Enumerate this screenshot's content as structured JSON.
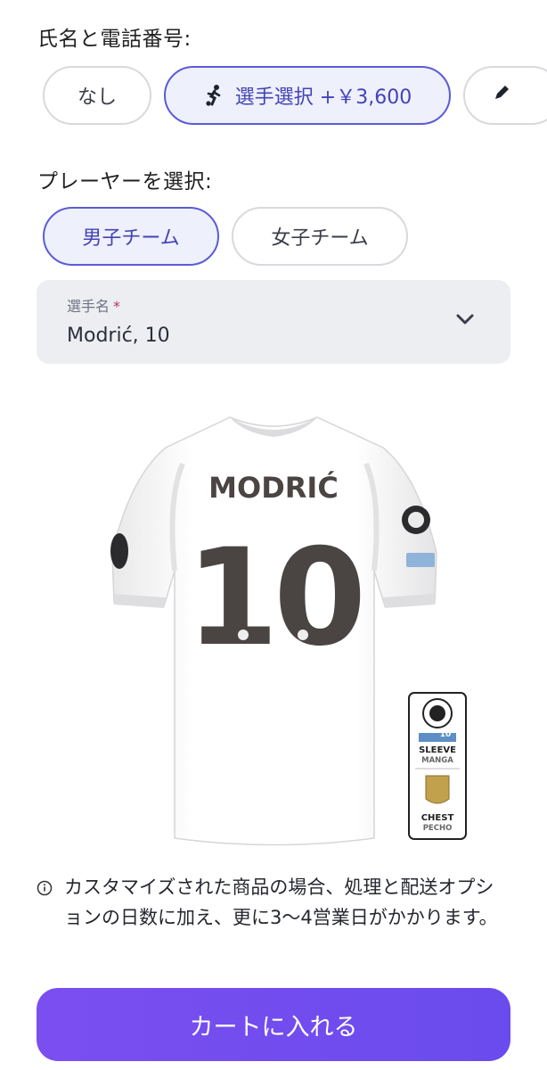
{
  "name_number": {
    "title": "氏名と電話番号:",
    "options": [
      {
        "label": "なし"
      },
      {
        "label": "選手選択 +￥3,600"
      }
    ],
    "selected_index": 1
  },
  "player": {
    "title": "プレーヤーを選択:",
    "teams": [
      {
        "label": "男子チーム"
      },
      {
        "label": "女子チーム"
      }
    ],
    "selected_team_index": 0,
    "select_label": "選手名",
    "required_mark": "*",
    "select_value": "Modrić, 10"
  },
  "preview": {
    "jersey_name": "MODRIĆ",
    "jersey_number": "10",
    "patch_sleeve_en": "SLEEVE",
    "patch_sleeve_es": "MANGA",
    "patch_chest_en": "CHEST",
    "patch_chest_es": "PECHO",
    "patch_sleeve_small": "10"
  },
  "notice": "カスタマイズされた商品の場合、処理と配送オプションの日数に加え、更に3〜4営業日がかかります。",
  "cart_button": "カートに入れる",
  "colors": {
    "accent": "#5b5bd6",
    "selected_bg": "#eef0fb",
    "cart_gradient_start": "#7b4ef0",
    "cart_gradient_end": "#6a4bed"
  },
  "icons": {
    "player_option": "soccer-player-icon",
    "third_option": "pen-icon",
    "dropdown": "chevron-down-icon",
    "notice": "info-icon"
  }
}
